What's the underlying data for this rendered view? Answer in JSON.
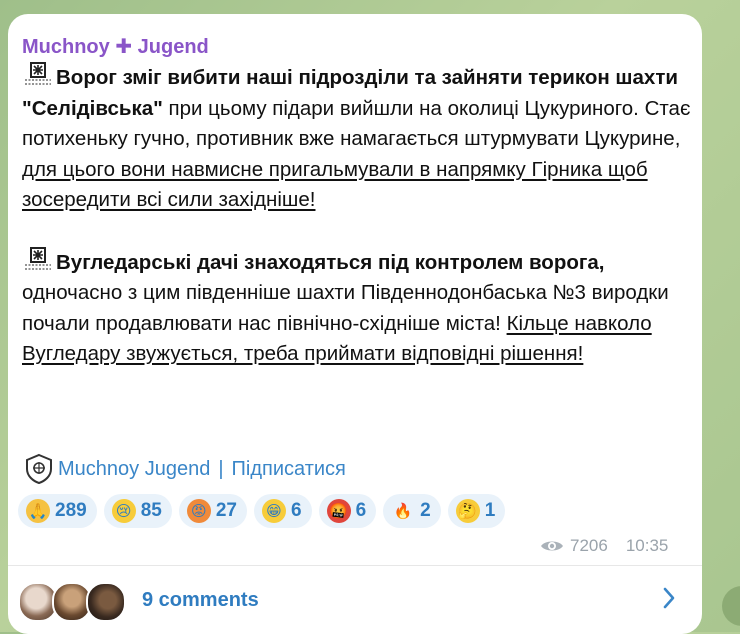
{
  "channel_name": "Muchnoy ✚ Jugend",
  "post": {
    "p1_bold": "Ворог зміг вибити наші підрозділи та зайняти терикон шахти \"Селідівська\"",
    "p1_normal": " при цьому підари вийшли на околиці Цукуриного. Стає потихеньку гучно, противник вже намагається штурмувати Цукурине, ",
    "p1_underlined": "для цього вони навмисне пригальмували в напрямку Гірника щоб зосередити всі сили західніше!",
    "p2_bold": "Вугледарські дачі знаходяться під контролем ворога,",
    "p2_normal": " одночасно з цим південніше шахти Південнодонбаська №3 виродки почали продавлювати нас північно-східніше міста! ",
    "p2_underlined": "Кільце навколо Вугледару звужується, треба приймати відповідні рішення!"
  },
  "signature": {
    "name": "Muchnoy Jugend",
    "separator": "|",
    "subscribe": "Підписатися"
  },
  "reactions": [
    {
      "icon": "folded-hands",
      "count": "289"
    },
    {
      "icon": "crying-face",
      "count": "85"
    },
    {
      "icon": "angry-face",
      "count": "27"
    },
    {
      "icon": "grinning-face",
      "count": "6"
    },
    {
      "icon": "cursing-face",
      "count": "6"
    },
    {
      "icon": "fire",
      "count": "2"
    },
    {
      "icon": "thinking-face",
      "count": "1"
    }
  ],
  "meta": {
    "views": "7206",
    "time": "10:35"
  },
  "comments": {
    "label": "9 comments"
  },
  "colors": {
    "channel": "#8a55c8",
    "link": "#3a86c8",
    "reaction_bg": "#e9f2fa"
  }
}
